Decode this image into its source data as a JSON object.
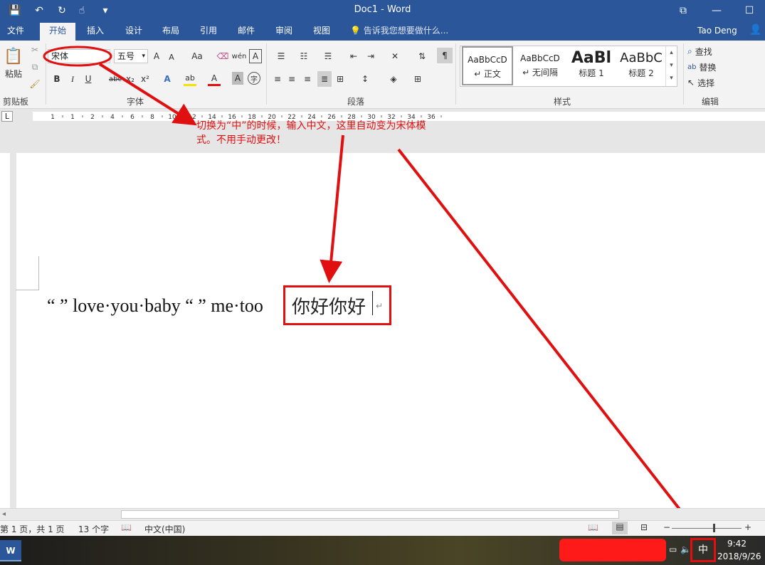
{
  "window": {
    "title": "Doc1 - Word",
    "qat": {
      "save_icon": "💾",
      "undo_icon": "↶",
      "redo_icon": "↻",
      "touch_icon": "☝",
      "customize_icon": "▾"
    },
    "controls": {
      "ribbon_display": "⧉",
      "minimize": "—",
      "maximize": "☐"
    }
  },
  "tabs": [
    {
      "label": "文件"
    },
    {
      "label": "开始"
    },
    {
      "label": "插入"
    },
    {
      "label": "设计"
    },
    {
      "label": "布局"
    },
    {
      "label": "引用"
    },
    {
      "label": "邮件"
    },
    {
      "label": "审阅"
    },
    {
      "label": "视图"
    }
  ],
  "tell_me": "告诉我您想要做什么...",
  "user_name": "Tao Deng",
  "ribbon": {
    "clipboard": {
      "paste_label": "粘贴",
      "group_label": "剪贴板"
    },
    "font": {
      "font_name": "宋体",
      "font_size": "五号",
      "grow": "A",
      "shrink": "A",
      "case": "Aa",
      "bold": "B",
      "italic": "I",
      "underline": "U",
      "strike": "abc",
      "sub": "x₂",
      "sup": "x²",
      "effects": "A",
      "highlight": "ab",
      "color": "A",
      "shading": "A",
      "enclose": "字",
      "group_label": "字体"
    },
    "paragraph": {
      "group_label": "段落"
    },
    "styles": {
      "items": [
        {
          "sample": "AaBbCcD",
          "name": "↵ 正文"
        },
        {
          "sample": "AaBbCcD",
          "name": "↵ 无间隔"
        },
        {
          "sample": "AaBl",
          "name": "标题 1"
        },
        {
          "sample": "AaBbC",
          "name": "标题 2"
        }
      ],
      "group_label": "样式"
    },
    "editing": {
      "find": "查找",
      "replace": "替换",
      "select": "选择",
      "group_label": "编辑"
    }
  },
  "ruler": {
    "tab_selector": "L",
    "numbers": [
      "1",
      "1",
      "2",
      "4",
      "6",
      "8",
      "10",
      "12",
      "14",
      "16",
      "18",
      "20",
      "22",
      "24",
      "26",
      "28",
      "30",
      "32",
      "34",
      "36"
    ]
  },
  "document": {
    "line_text": "“ ” love·you·baby “ ” me·too",
    "chinese_text": "你好你好",
    "para_mark": "↵"
  },
  "annotation": {
    "text": "切换为“中”的时候，输入中文，这里自动变为宋体模式。不用手动更改！"
  },
  "status": {
    "page": "第 1 页，共 1 页",
    "words": "13 个字",
    "language": "中文(中国)",
    "zoom_minus": "−",
    "zoom_plus": "+"
  },
  "taskbar": {
    "word_icon": "W",
    "ime": "中",
    "time": "9:42",
    "date": "2018/9/26"
  },
  "colors": {
    "accent": "#2b579a",
    "annotation_red": "#e01010"
  }
}
